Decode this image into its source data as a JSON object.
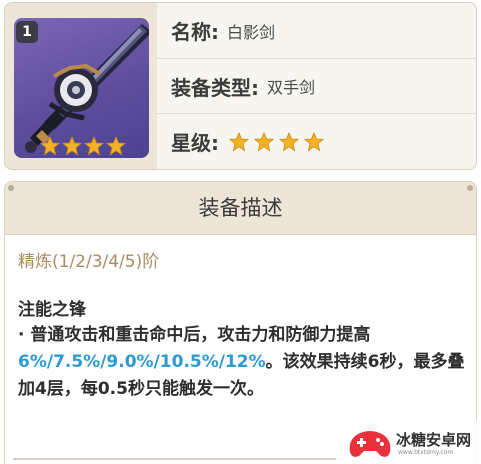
{
  "info": {
    "refinement_badge": "1",
    "thumbnail_rarity": 4,
    "name_label": "名称:",
    "name_value": "白影剑",
    "type_label": "装备类型:",
    "type_value": "双手剑",
    "rarity_label": "星级:",
    "rarity_stars": 4,
    "star_color": "#f3b128",
    "icon": "claymore-icon"
  },
  "description": {
    "header": "装备描述",
    "refinement_levels": "精炼(1/2/3/4/5)阶",
    "effect_name": "注能之锋",
    "effect_text_1": "· 普通攻击和重击命中后，攻击力和防御力提高",
    "effect_values": "6%/7.5%/9.0%/10.5%/12%",
    "effect_text_2": "。该效果持续6秒，最多叠加4层，每0.5秒只能触发一次。",
    "highlight_color": "#2c9bd1"
  },
  "watermark": {
    "text": "冰糖安卓网",
    "sub": "www.btxtdmy.com"
  }
}
